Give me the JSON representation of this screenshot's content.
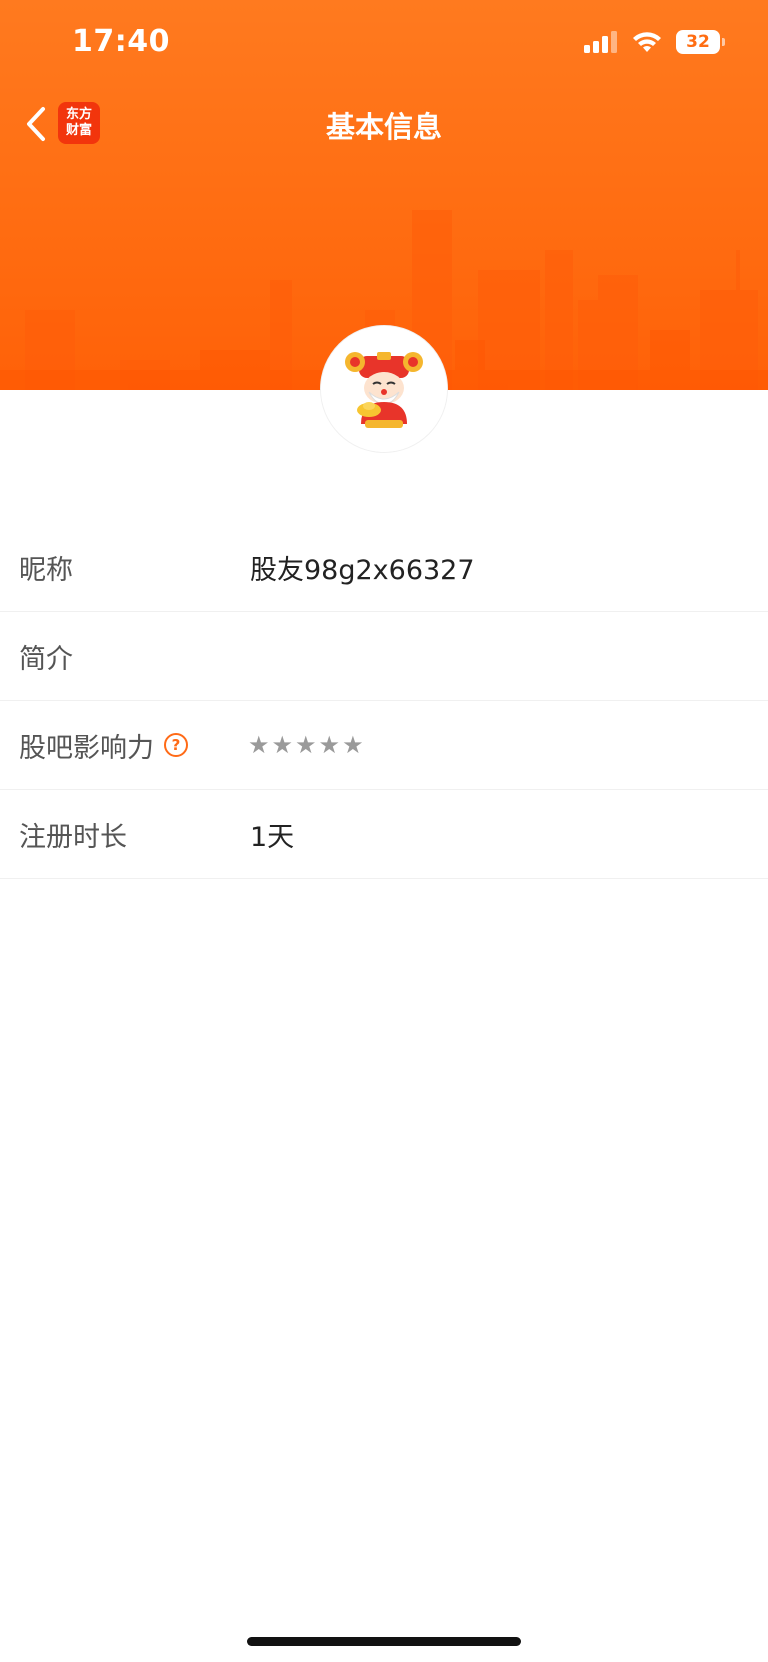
{
  "status_bar": {
    "time": "17:40",
    "battery_level": "32",
    "signal_icon": "cellular-signal-icon",
    "wifi_icon": "wifi-icon"
  },
  "navbar": {
    "title": "基本信息",
    "back_icon": "chevron-left-icon",
    "logo_line1": "东方",
    "logo_line2": "财富"
  },
  "profile": {
    "avatar_icon": "caishen-avatar-icon"
  },
  "info_rows": [
    {
      "label": "昵称",
      "value": "股友98g2x66327"
    },
    {
      "label": "简介",
      "value": ""
    },
    {
      "label": "股吧影响力",
      "stars": 5,
      "filled": 0,
      "help_icon": "question-circle-icon",
      "help_glyph": "?"
    },
    {
      "label": "注册时长",
      "value": "1天"
    }
  ],
  "colors": {
    "header": "#ff6d12",
    "accent": "#ff6a16",
    "logo_red": "#f2350c",
    "star_gray": "#9a9a9a"
  }
}
